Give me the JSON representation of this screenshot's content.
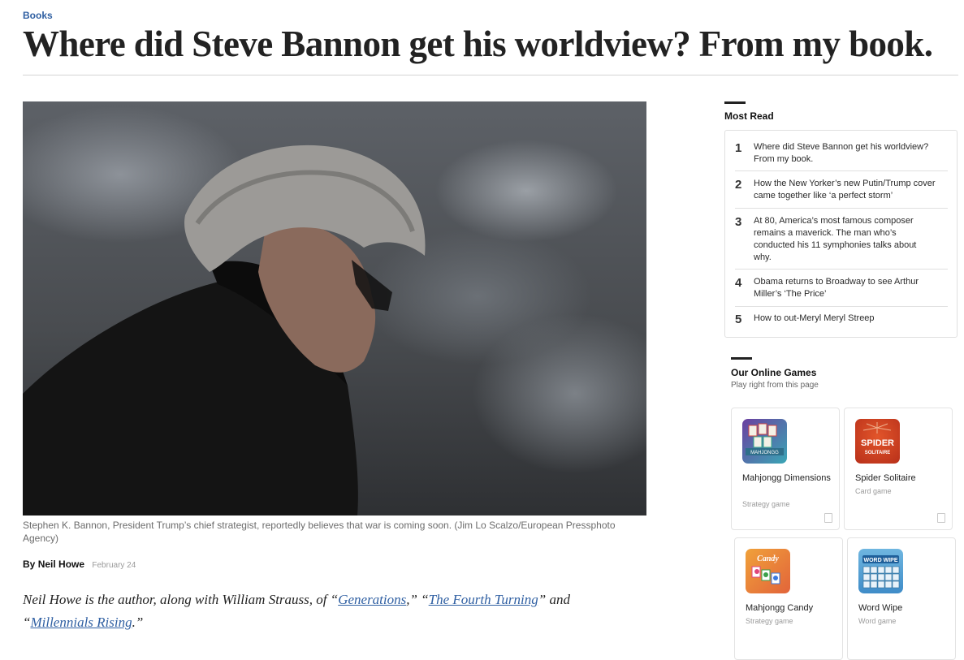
{
  "section": "Books",
  "headline": "Where did Steve Bannon get his worldview? From my book.",
  "photo_icon": "portrait-photo",
  "caption": "Stephen K. Bannon, President Trump’s chief strategist, reportedly believes that war is coming soon. (Jim Lo Scalzo/European Pressphoto Agency)",
  "byline": {
    "by": "By",
    "author": "Neil Howe",
    "date": "February 24"
  },
  "intro": {
    "t1": "Neil Howe is the author, along with William Strauss, of “",
    "l1": "Generations",
    "t2": ",” “",
    "l2": "The Fourth Turning",
    "t3": "” and “",
    "l3": "Millennials Rising",
    "t4": ".”"
  },
  "most_read": {
    "title": "Most Read",
    "items": [
      {
        "num": "1",
        "text": "Where did Steve Bannon get his worldview? From my book."
      },
      {
        "num": "2",
        "text": "How the New Yorker’s new Putin/Trump cover came together like ‘a perfect storm’"
      },
      {
        "num": "3",
        "text": "At 80, America’s most famous composer remains a maverick. The man who’s conducted his 11 symphonies talks about why."
      },
      {
        "num": "4",
        "text": "Obama returns to Broadway to see Arthur Miller’s ‘The Price’"
      },
      {
        "num": "5",
        "text": "How to out-Meryl Meryl Streep"
      }
    ]
  },
  "online_games": {
    "title": "Our Online Games",
    "subtitle": "Play right from this page",
    "games": [
      {
        "name": "Mahjongg Dimensions",
        "type": "Strategy game",
        "thumb_label": "MAHJONGG",
        "icon": "mahjongg-dimensions-icon"
      },
      {
        "name": "Spider Solitaire",
        "type": "Card game",
        "thumb_label": "SPIDER SOLITAIRE",
        "icon": "spider-solitaire-icon"
      },
      {
        "name": "Mahjongg Candy",
        "type": "Strategy game",
        "thumb_label": "Candy",
        "icon": "mahjongg-candy-icon"
      },
      {
        "name": "Word Wipe",
        "type": "Word game",
        "thumb_label": "WORD WIPE",
        "icon": "word-wipe-icon"
      }
    ]
  }
}
